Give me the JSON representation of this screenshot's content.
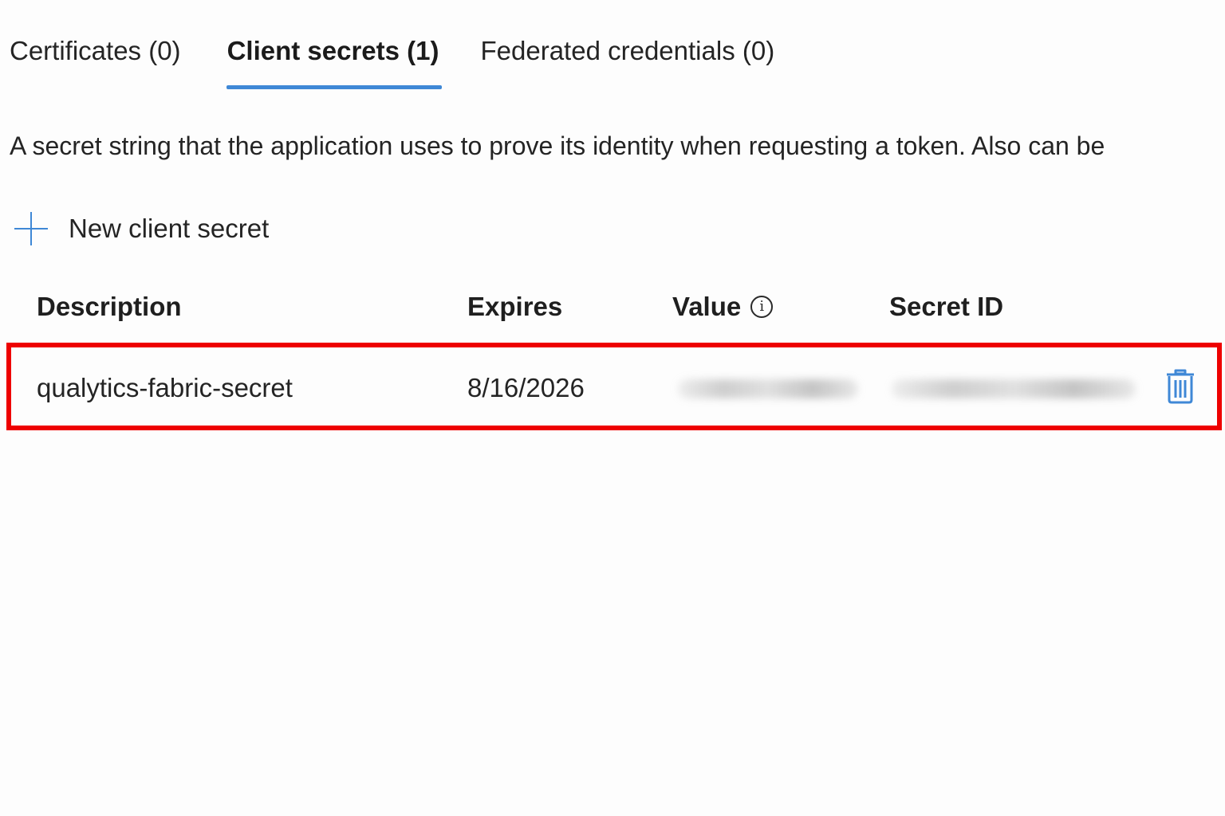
{
  "tabs": [
    {
      "label": "Certificates (0)",
      "active": false
    },
    {
      "label": "Client secrets (1)",
      "active": true
    },
    {
      "label": "Federated credentials (0)",
      "active": false
    }
  ],
  "description": "A secret string that the application uses to prove its identity when requesting a token. Also can be",
  "new_secret": {
    "label": "New client secret",
    "icon": "plus-icon"
  },
  "table": {
    "headers": {
      "description": "Description",
      "expires": "Expires",
      "value": "Value",
      "secret_id": "Secret ID"
    },
    "rows": [
      {
        "description": "qualytics-fabric-secret",
        "expires": "8/16/2026",
        "value": "",
        "secret_id": ""
      }
    ]
  },
  "colors": {
    "accent": "#3f88d6",
    "highlight_border": "#ee0000"
  },
  "icons": {
    "info": "info-icon",
    "delete": "trash-icon"
  }
}
